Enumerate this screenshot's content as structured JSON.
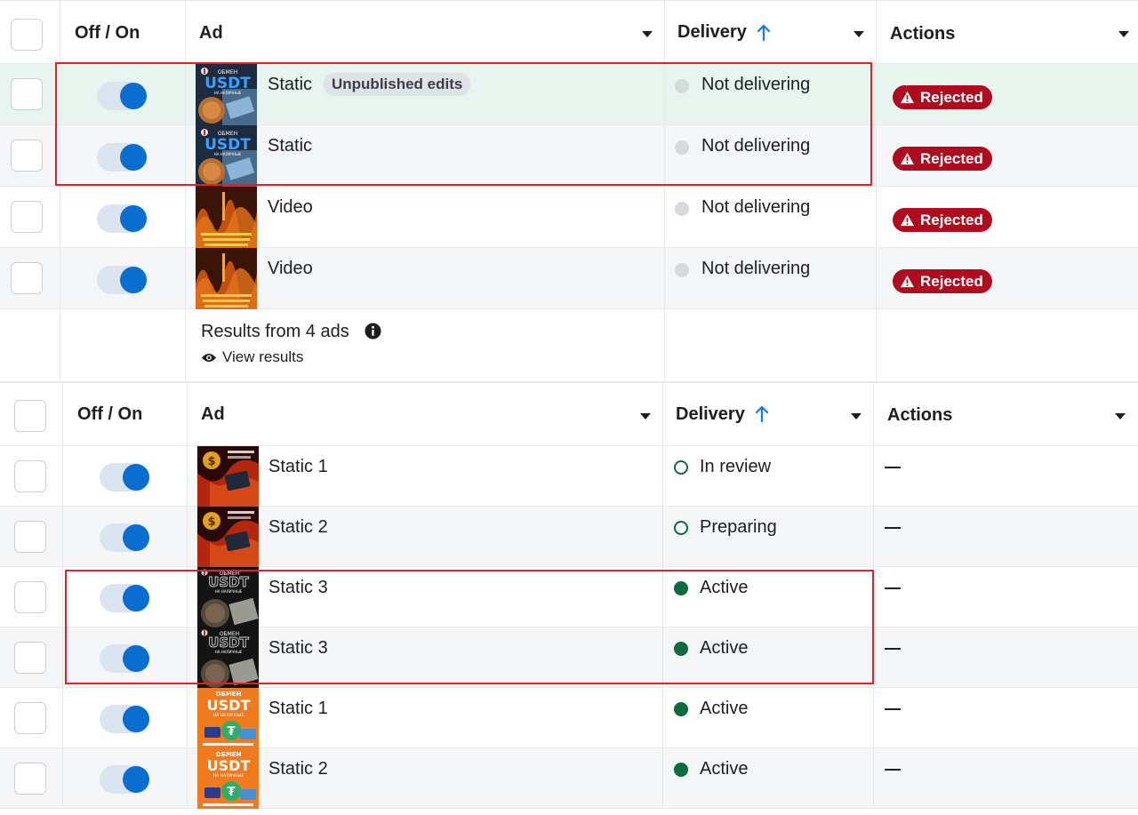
{
  "table1": {
    "headers": {
      "toggle": "Off / On",
      "ad": "Ad",
      "delivery": "Delivery",
      "actions": "Actions"
    },
    "rows": [
      {
        "name": "Static",
        "badge": "Unpublished edits",
        "delivery": "Not delivering",
        "status": "Rejected",
        "thumb": "usdt-blue"
      },
      {
        "name": "Static",
        "badge": "",
        "delivery": "Not delivering",
        "status": "Rejected",
        "thumb": "usdt-blue"
      },
      {
        "name": "Video",
        "badge": "",
        "delivery": "Not delivering",
        "status": "Rejected",
        "thumb": "orange-wave"
      },
      {
        "name": "Video",
        "badge": "",
        "delivery": "Not delivering",
        "status": "Rejected",
        "thumb": "orange-wave"
      }
    ],
    "summary": {
      "results": "Results from 4 ads",
      "view": "View results"
    }
  },
  "table2": {
    "headers": {
      "toggle": "Off / On",
      "ad": "Ad",
      "delivery": "Delivery",
      "actions": "Actions"
    },
    "rows": [
      {
        "name": "Static 1",
        "delivery": "In review",
        "dot": "outline",
        "action": "—",
        "thumb": "dark-red-dollar"
      },
      {
        "name": "Static 2",
        "delivery": "Preparing",
        "dot": "outline",
        "action": "—",
        "thumb": "dark-red-dollar"
      },
      {
        "name": "Static 3",
        "delivery": "Active",
        "dot": "filled",
        "action": "—",
        "thumb": "dark-coin"
      },
      {
        "name": "Static 3",
        "delivery": "Active",
        "dot": "filled",
        "action": "—",
        "thumb": "dark-coin"
      },
      {
        "name": "Static 1",
        "delivery": "Active",
        "dot": "filled",
        "action": "—",
        "thumb": "orange-usdt"
      },
      {
        "name": "Static 2",
        "delivery": "Active",
        "dot": "filled",
        "action": "—",
        "thumb": "orange-usdt"
      }
    ]
  },
  "thumb_text": {
    "usdt": "USDT",
    "obmen": "ОБМЕН",
    "nal": "НА НАЛИЧНЫЕ"
  },
  "colors": {
    "accent_blue": "#0a6ed1",
    "rejected_red": "#b00b1e",
    "active_green": "#0c6b3f",
    "highlight_box": "#e0202b",
    "highlight_row": "#e8f4ee"
  }
}
